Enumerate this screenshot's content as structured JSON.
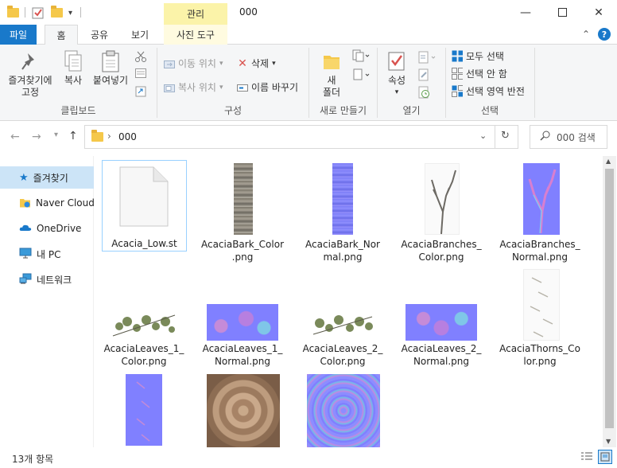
{
  "window": {
    "title": "000",
    "context_tab_header": "관리"
  },
  "tabs": [
    {
      "label": "파일"
    },
    {
      "label": "홈"
    },
    {
      "label": "공유"
    },
    {
      "label": "보기"
    },
    {
      "label": "사진 도구"
    }
  ],
  "ribbon": {
    "clipboard": {
      "pin_label": "즐겨찾기에\n고정",
      "copy_label": "복사",
      "paste_label": "붙여넣기",
      "group_label": "클립보드"
    },
    "organize": {
      "move_to": "이동 위치",
      "copy_to": "복사 위치",
      "delete": "삭제",
      "rename": "이름 바꾸기",
      "group_label": "구성"
    },
    "new": {
      "new_folder": "새\n폴더",
      "group_label": "새로 만들기"
    },
    "open": {
      "properties": "속성",
      "group_label": "열기"
    },
    "select": {
      "select_all": "모두 선택",
      "select_none": "선택 안 함",
      "invert": "선택 영역 반전",
      "group_label": "선택"
    }
  },
  "address": {
    "path": "000",
    "search_placeholder": "000 검색"
  },
  "nav": {
    "items": [
      {
        "label": "즐겨찾기",
        "icon": "star-icon"
      },
      {
        "label": "Naver Cloud",
        "icon": "naver-cloud-icon"
      },
      {
        "label": "OneDrive",
        "icon": "onedrive-icon"
      },
      {
        "label": "내 PC",
        "icon": "pc-icon"
      },
      {
        "label": "네트워크",
        "icon": "network-icon"
      }
    ]
  },
  "files": [
    {
      "name": "Acacia_Low.st",
      "kind": "blank-file"
    },
    {
      "name": "AcaciaBark_Color\n.png",
      "kind": "bark-color"
    },
    {
      "name": "AcaciaBark_Nor\nmal.png",
      "kind": "bark-normal"
    },
    {
      "name": "AcaciaBranches_\nColor.png",
      "kind": "branches-color"
    },
    {
      "name": "AcaciaBranches_\nNormal.png",
      "kind": "branches-normal"
    },
    {
      "name": "AcaciaLeaves_1_\nColor.png",
      "kind": "leaves-color"
    },
    {
      "name": "AcaciaLeaves_1_\nNormal.png",
      "kind": "leaves-normal"
    },
    {
      "name": "AcaciaLeaves_2_\nColor.png",
      "kind": "leaves-color"
    },
    {
      "name": "AcaciaLeaves_2_\nNormal.png",
      "kind": "leaves-normal"
    },
    {
      "name": "AcaciaThorns_Co\nlor.png",
      "kind": "thorns-color"
    },
    {
      "name": "",
      "kind": "thorns-normal"
    },
    {
      "name": "",
      "kind": "wood-color"
    },
    {
      "name": "",
      "kind": "wood-normal"
    }
  ],
  "status": {
    "item_count": "13개 항목"
  },
  "colors": {
    "accent": "#1979ca",
    "context_tab": "#fbf3a9",
    "selected_nav": "#cce4f7",
    "normal_map": "#8080ff"
  }
}
